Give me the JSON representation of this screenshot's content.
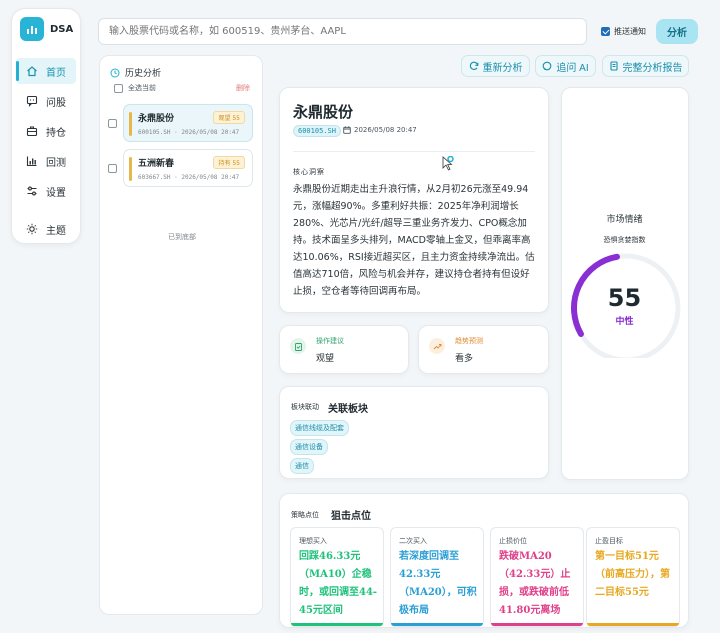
{
  "app": {
    "name": "DSA"
  },
  "nav": {
    "items": [
      {
        "label": "首页",
        "icon": "home-icon"
      },
      {
        "label": "问股",
        "icon": "chat-icon"
      },
      {
        "label": "持仓",
        "icon": "briefcase-icon"
      },
      {
        "label": "回测",
        "icon": "bar-chart-icon"
      },
      {
        "label": "设置",
        "icon": "sliders-icon"
      },
      {
        "label": "主题",
        "icon": "sun-icon"
      }
    ]
  },
  "search": {
    "placeholder": "输入股票代码或名称，如 600519、贵州茅台、AAPL",
    "notify_label": "推送通知",
    "notify_checked": true,
    "analyze_label": "分析"
  },
  "history": {
    "title": "历史分析",
    "select_all": "全选当前",
    "delete": "删除",
    "items": [
      {
        "name": "永鼎股份",
        "code": "600105.SH",
        "time": "2026/05/08 20:47",
        "badge": "观望 55"
      },
      {
        "name": "五洲新春",
        "code": "603667.SH",
        "time": "2026/05/08 20:47",
        "badge": "持有 55"
      }
    ],
    "end_text": "已到底部"
  },
  "actions": {
    "reanalyze": "重新分析",
    "ask_ai": "追问 AI",
    "full_report": "完整分析报告"
  },
  "detail": {
    "name": "永鼎股份",
    "code": "600105.SH",
    "time": "2026/05/08 20:47",
    "core_label": "核心洞察",
    "core_text": "永鼎股份近期走出主升浪行情，从2月初26元涨至49.94元，涨幅超90%。多重利好共振：2025年净利润增长280%、光芯片/光纤/超导三重业务齐发力、CPO概念加持。技术面呈多头排列，MACD零轴上金叉，但乖离率高达10.06%，RSI接近超买区，且主力资金持续净流出。估值高达710倍，风险与机会并存，建议持仓者持有但设好止损，空仓者等待回调再布局。"
  },
  "suggestion": {
    "label": "操作建议",
    "value": "观望",
    "color": "#2fa36b"
  },
  "trend": {
    "label": "趋势预测",
    "value": "看多",
    "color": "#e08a2b"
  },
  "sector": {
    "label": "板块联动",
    "title": "关联板块",
    "tags": [
      "通信线缆及配套",
      "通信设备",
      "通信"
    ]
  },
  "mood": {
    "title": "市场情绪",
    "subtitle": "恐惧贪婪指数",
    "value": 55,
    "level": "中性",
    "color": "#8a2fd1"
  },
  "strategy": {
    "label": "策略点位",
    "title": "狙击点位",
    "points": [
      {
        "label": "理想买入",
        "value": "回踩46.33元（MA10）企稳时，或回调至44-45元区间",
        "color": "#1ec27a"
      },
      {
        "label": "二次买入",
        "value": "若深度回调至42.33元（MA20），可积极布局",
        "color": "#2a9fd6"
      },
      {
        "label": "止损价位",
        "value": "跌破MA20（42.33元）止损，或跌破前低41.80元离场",
        "color": "#e0408a"
      },
      {
        "label": "止盈目标",
        "value": "第一目标51元（前高压力），第二目标55元",
        "color": "#e8a820"
      }
    ]
  }
}
